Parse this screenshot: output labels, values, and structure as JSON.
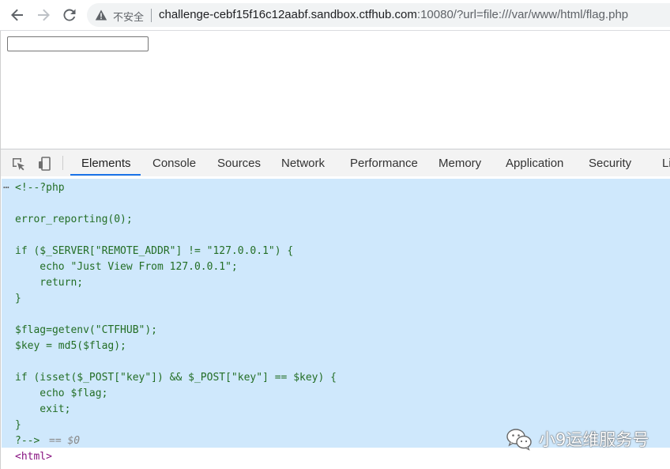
{
  "browser": {
    "back_icon": "arrow-left-icon",
    "forward_icon": "arrow-right-icon",
    "reload_icon": "reload-icon",
    "security_icon": "warning-triangle-icon",
    "security_label": "不安全",
    "url_host": "challenge-cebf15f16c12aabf.sandbox.ctfhub.com",
    "url_rest": ":10080/?url=file:///var/www/html/flag.php"
  },
  "page": {
    "input_value": ""
  },
  "devtools": {
    "inspect_icon": "inspect-element-icon",
    "device_icon": "device-toolbar-icon",
    "tabs": [
      {
        "label": "Elements"
      },
      {
        "label": "Console"
      },
      {
        "label": "Sources"
      },
      {
        "label": "Network"
      },
      {
        "label": "Performance"
      },
      {
        "label": "Memory"
      },
      {
        "label": "Application"
      },
      {
        "label": "Security"
      },
      {
        "label": "Li"
      }
    ],
    "active_tab": "Elements",
    "elements": {
      "ellipsis": "⋯",
      "comment_code": "<!--?php\n\nerror_reporting(0);\n\nif ($_SERVER[\"REMOTE_ADDR\"] != \"127.0.0.1\") {\n    echo \"Just View From 127.0.0.1\";\n    return;\n}\n\n$flag=getenv(\"CTFHUB\");\n$key = md5($flag);\n\nif (isset($_POST[\"key\"]) && $_POST[\"key\"] == $key) {\n    echo $flag;\n    exit;\n}\n?-->",
      "selected_marker": "== $0",
      "html_tag": "<html>"
    }
  },
  "watermark": {
    "icon": "wechat-icon",
    "text": "小9运维服务号"
  },
  "colors": {
    "selected_bg": "#cfe8fc",
    "comment": "#236e25",
    "tag": "#881280",
    "active_tab_underline": "#1a73e8"
  }
}
